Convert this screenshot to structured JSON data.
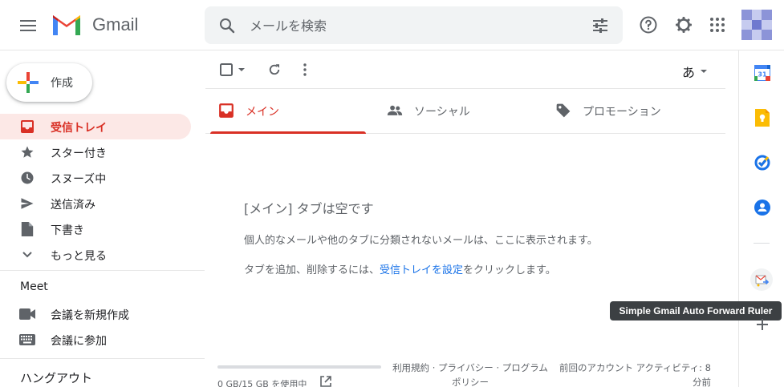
{
  "app": {
    "brand_name": "Gmail"
  },
  "search": {
    "placeholder": "メールを検索"
  },
  "compose": {
    "label": "作成"
  },
  "nav": {
    "items": [
      {
        "label": "受信トレイ",
        "icon": "inbox-icon",
        "active": true
      },
      {
        "label": "スター付き",
        "icon": "star-icon"
      },
      {
        "label": "スヌーズ中",
        "icon": "clock-icon"
      },
      {
        "label": "送信済み",
        "icon": "send-icon"
      },
      {
        "label": "下書き",
        "icon": "draft-icon"
      },
      {
        "label": "もっと見る",
        "icon": "chevron-down-icon"
      }
    ]
  },
  "meet": {
    "title": "Meet",
    "items": [
      {
        "label": "会議を新規作成",
        "icon": "videocam-icon"
      },
      {
        "label": "会議に参加",
        "icon": "keyboard-icon"
      }
    ]
  },
  "hangouts": {
    "title": "ハングアウト"
  },
  "toolbar": {
    "input_tool": "あ"
  },
  "tabs": [
    {
      "label": "メイン",
      "icon": "inbox-icon",
      "active": true
    },
    {
      "label": "ソーシャル",
      "icon": "people-icon"
    },
    {
      "label": "プロモーション",
      "icon": "tag-icon"
    }
  ],
  "empty_state": {
    "title": "[メイン] タブは空です",
    "line1": "個人的なメールや他のタブに分類されないメールは、ここに表示されます。",
    "line2_prefix": "タブを追加、削除するには、",
    "line2_link": "受信トレイを設定",
    "line2_suffix": "をクリックします。"
  },
  "footer": {
    "storage": "0 GB/15 GB を使用中",
    "storage_fraction": 0.0,
    "legal_line1": "利用規約 · プライバシー · プログラム",
    "legal_line2": "ポリシー",
    "activity_line1": "前回のアカウント アクティビティ: 8",
    "activity_line2": "分前"
  },
  "side_panel": {
    "apps": [
      "calendar-icon",
      "keep-icon",
      "tasks-icon",
      "contacts-icon",
      "extension-icon"
    ],
    "calendar_day": "31",
    "tooltip": "Simple Gmail Auto Forward Ruler"
  },
  "colors": {
    "accent_red": "#d93025",
    "active_bg": "#fce8e6",
    "link_blue": "#1a73e8",
    "search_bg": "#f1f3f4"
  }
}
